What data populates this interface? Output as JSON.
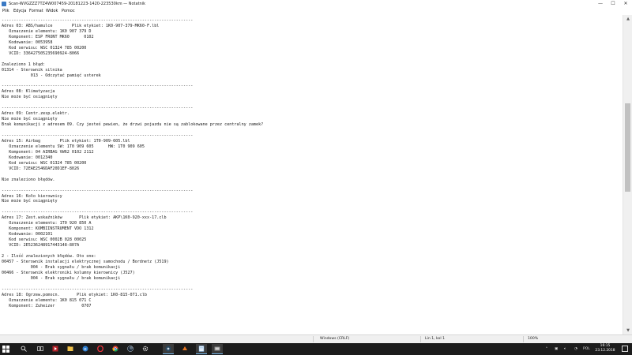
{
  "window": {
    "title": "Scan-WVGZZZ7TZ4W007459-20181223-1420-223530km — Notatnik",
    "buttons": {
      "minimize": "—",
      "maximize": "☐",
      "close": "✕"
    }
  },
  "menu": [
    "Plik",
    "Edycja",
    "Format",
    "Widok",
    "Pomoc"
  ],
  "document_lines": [
    "-------------------------------------------------------------------------------",
    "Adres 03: ABS/hamulce        Plik etykiet: 1K0-907-379-MK60-F.lbl",
    "   Oznaczenie elementu: 1K0 907 379 D",
    "   Komponent: ESP FRONT MK60      0102",
    "   Kodowanie: 0053958",
    "   Kod serwisu: WSC 01324 785 00200",
    "   VCID: 336427505235690924-8066",
    "",
    "Znaleziono 1 błąd:",
    "01314 - Sterownik silnika",
    "            013 - Odczytać pamięć usterek",
    "",
    "-------------------------------------------------------------------------------",
    "Adres 08: Klimatyzacja",
    "Nie może być osiągnięty",
    "",
    "-------------------------------------------------------------------------------",
    "Adres 09: Centr.zesp.elektr.",
    "Nie może być osiągnięty",
    "Brak komunikacji z adresem 09. Czy jesteś pewien, że drzwi pojazdu nie są zablokowane przez centralny zamek?",
    "",
    "-------------------------------------------------------------------------------",
    "Adres 15: Airbag        Plik etykiet: 1T0-909-605.lbl",
    "   Oznaczenie elementu SW: 1T0 909 605      HW: 1T0 909 605",
    "   Komponent: 04 AIRBAG VW62 0102 2112",
    "   Kodowanie: 0012340",
    "   Kod serwisu: WSC 01324 785 00200",
    "   VCID: 72EAE2546DAF20D1EF-8026",
    "",
    "Nie znaleziono błędów.",
    "",
    "-------------------------------------------------------------------------------",
    "Adres 16: Koło kierownicy",
    "Nie może być osiągnięty",
    "",
    "-------------------------------------------------------------------------------",
    "Adres 17: Zest.wskaźników       Plik etykiet: AKP\\1K0-920-xxx-17.clb",
    "   Oznaczenie elementu: 1T0 920 850 A",
    "   Komponent: KOMBIINSTRUMENT VDO 1312",
    "   Kodowanie: 0002101",
    "   Kod serwisu: WSC 0002B 028 00025",
    "   VCID: 2E5236248917443148-807A",
    "",
    "2 - Ilość znalezionych błędów. Oto one:",
    "00457 - Sterownik instalacji elektrycznej samochodu / Bordnetz (J519)",
    "            004 - Brak sygnału / brak komunikacji",
    "00466 - Sterownik elektroniki kolumny kierownicy (J527)",
    "            004 - Brak sygnału / brak komunikacji",
    "",
    "-------------------------------------------------------------------------------",
    "Adres 18: Ogrzew.pomocn.       Plik etykiet: 1K0-815-071.clb",
    "   Oznaczenie elementu: 1K0 815 071 C",
    "   Komponent: Zuheizer           0707"
  ],
  "status": {
    "encoding": "Windows (CRLF)",
    "position": "Lin 1, kol 1",
    "zoom": "100%"
  },
  "tray": {
    "language": "POL",
    "time": "16:15",
    "date": "23.12.2018"
  },
  "colors": {
    "taskbar": "#1c1c1c",
    "accent": "#76b9ed"
  }
}
